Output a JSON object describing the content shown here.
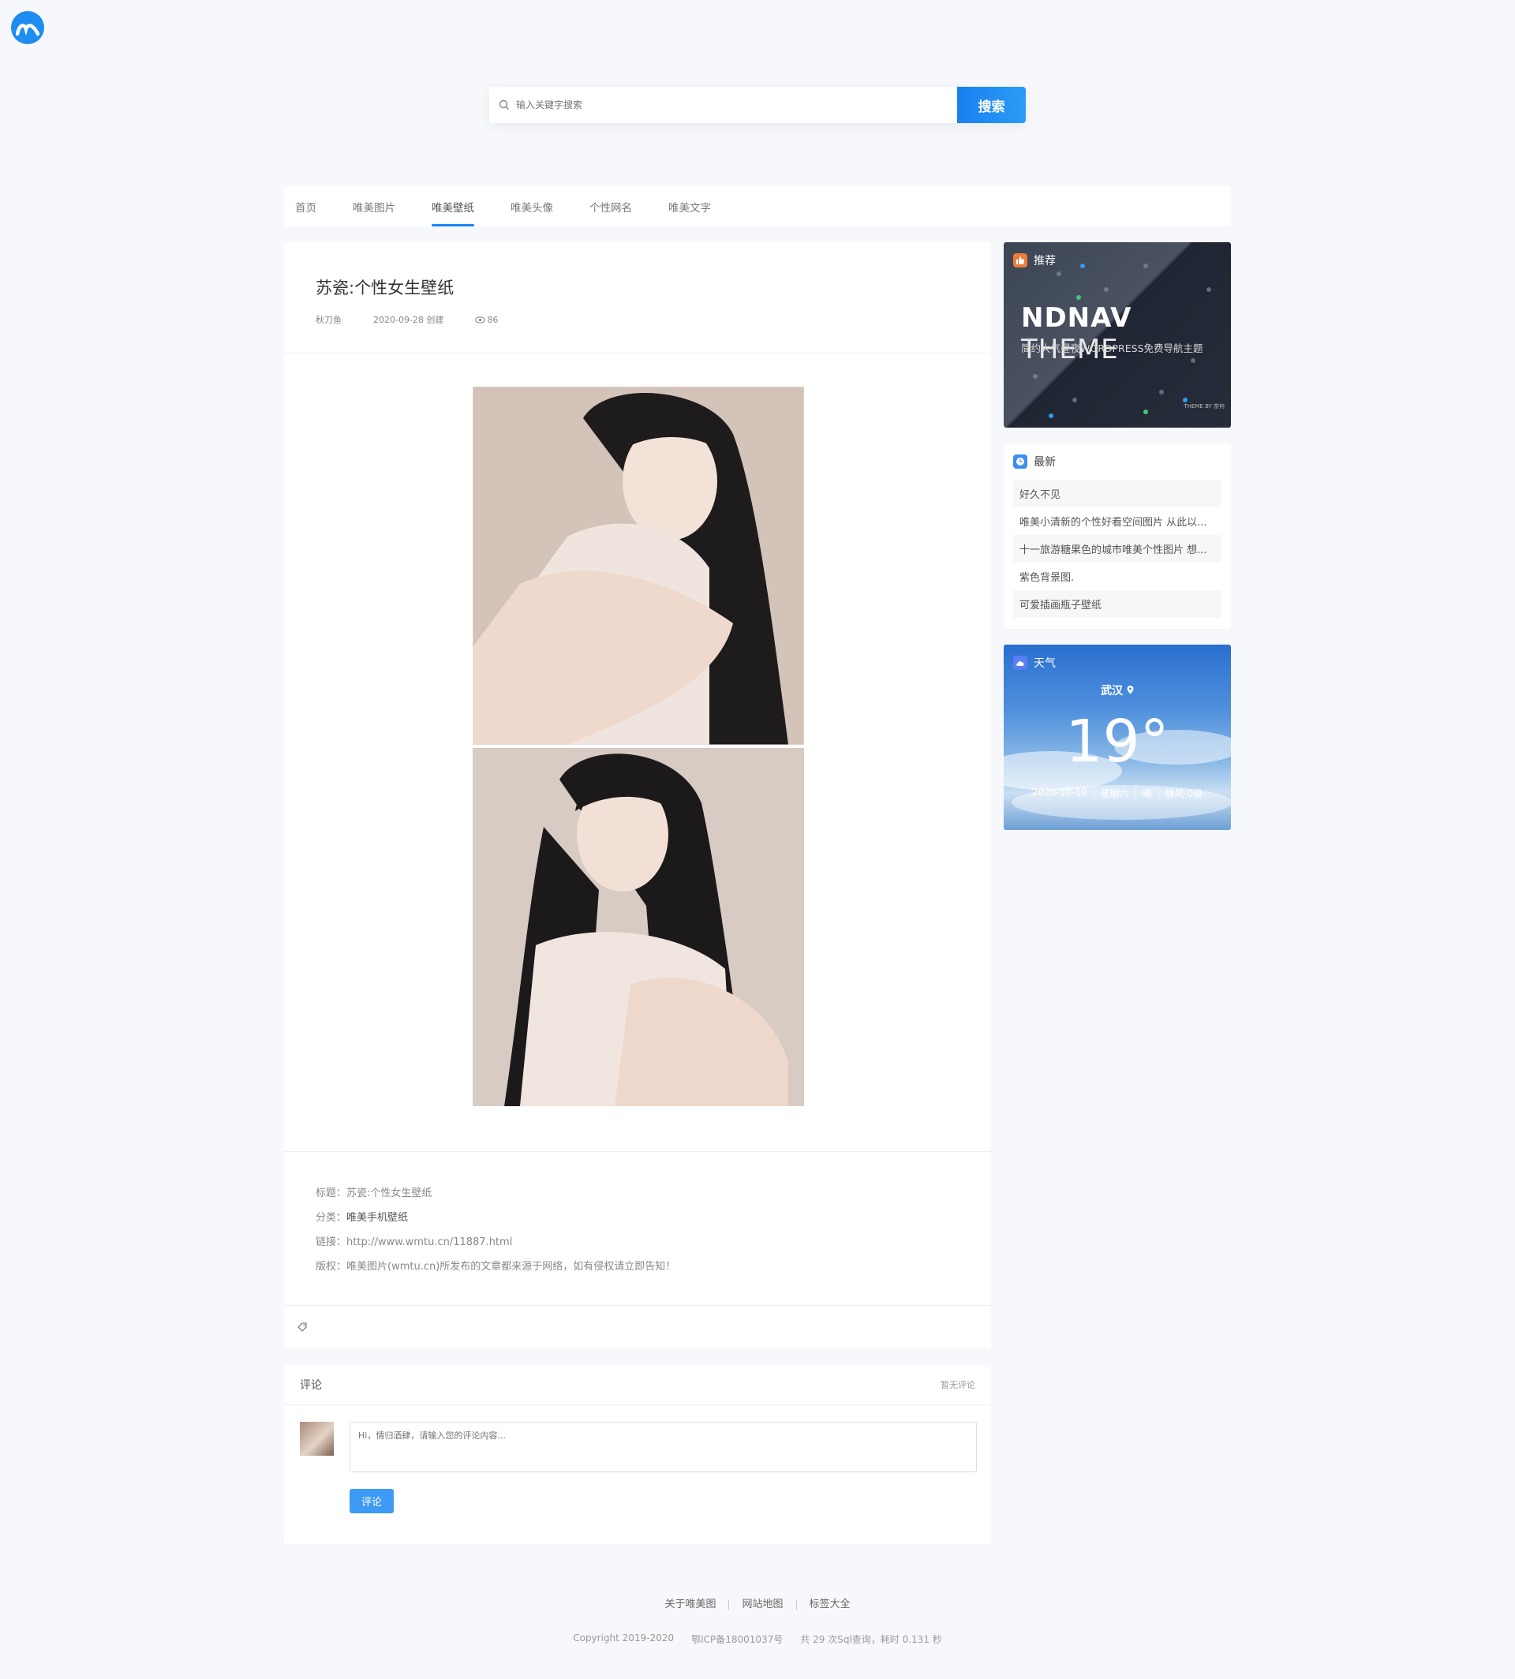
{
  "search": {
    "placeholder": "输入关键字搜索",
    "button": "搜索"
  },
  "nav": [
    {
      "label": "首页",
      "active": false
    },
    {
      "label": "唯美图片",
      "active": false
    },
    {
      "label": "唯美壁纸",
      "active": true
    },
    {
      "label": "唯美头像",
      "active": false
    },
    {
      "label": "个性网名",
      "active": false
    },
    {
      "label": "唯美文字",
      "active": false
    }
  ],
  "article": {
    "title": "苏瓷:个性女生壁纸",
    "author": "秋刀鱼",
    "created": "2020-09-28 创建",
    "views": "86",
    "info": {
      "title_label": "标题：",
      "title_value": "苏瓷:个性女生壁纸",
      "category_label": "分类：",
      "category_value": "唯美手机壁纸",
      "link_label": "链接：",
      "link_value": "http://www.wmtu.cn/11887.html",
      "copyright_label": "版权：",
      "copyright_value": "唯美图片(wmtu.cn)所发布的文章都来源于网络，如有侵权请立即告知！"
    }
  },
  "comments": {
    "title": "评论",
    "status": "暂无评论",
    "placeholder": "Hi，情归酒肆，请输入您的评论内容...",
    "submit": "评论"
  },
  "sidebar": {
    "recommend": {
      "label": "推荐",
      "brand": "NDNAV",
      "brand_thin": "THEME",
      "subtitle": "简约大气昼夜WORDPRESS免费导航主题",
      "small": "THEME BY 奈何"
    },
    "latest": {
      "label": "最新",
      "items": [
        "好久不见",
        "唯美小清新的个性好看空间图片 从此以...",
        "十一旅游糖果色的城市唯美个性图片 想...",
        "紫色背景图.",
        "可爱插画瓶子壁纸"
      ]
    },
    "weather": {
      "label": "天气",
      "city": "武汉",
      "temp": "19°",
      "date": "2020-10-10",
      "weekday": "星期六",
      "condition": "晴",
      "wind": "静风 0级"
    }
  },
  "footer": {
    "links": [
      "关于唯美图",
      "网站地图",
      "标签大全"
    ],
    "copyright": "Copyright 2019-2020",
    "icp": "鄂ICP备18001037号",
    "stats": "共 29 次Sql查询，耗时 0.131 秒"
  },
  "colors": {
    "accent": "#1e86f1",
    "button": "#3d9af5"
  }
}
